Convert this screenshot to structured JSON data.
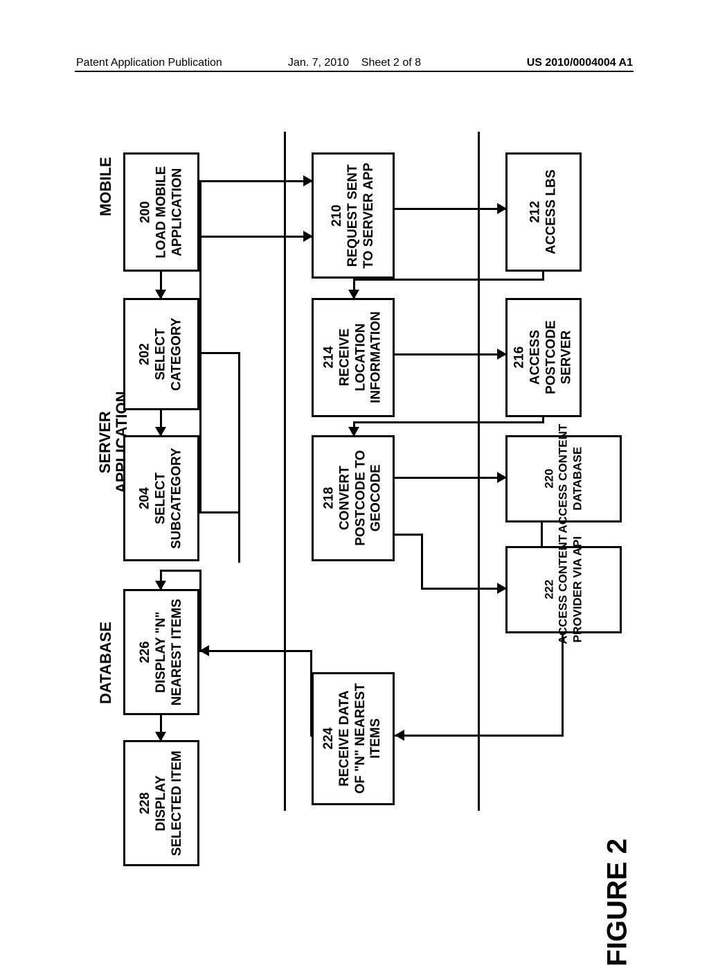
{
  "header": {
    "left": "Patent Application Publication",
    "mid_date": "Jan. 7, 2010",
    "mid_sheet": "Sheet 2 of 8",
    "right": "US 2010/0004004 A1"
  },
  "figure_label": "FIGURE 2",
  "lanes": {
    "mobile": "MOBILE",
    "server": "SERVER\nAPPLICATION",
    "database": "DATABASE"
  },
  "boxes": {
    "b200": "200\nLOAD MOBILE\nAPPLICATION",
    "b202": "202\nSELECT\nCATEGORY",
    "b204": "204\nSELECT\nSUBCATEGORY",
    "b210": "210\nREQUEST SENT\nTO SERVER APP",
    "b212": "212\nACCESS LBS",
    "b214": "214\nRECEIVE\nLOCATION\nINFORMATION",
    "b216": "216\nACCESS\nPOSTCODE\nSERVER",
    "b218": "218\nCONVERT\nPOSTCODE TO\nGEOCODE",
    "b220": "220\nACCESS CONTENT\nDATABASE",
    "b222": "222\nACCESS CONTENT\nPROVIDER VIA API",
    "b224": "224\nRECEIVE DATA\nOF \"N\" NEAREST\nITEMS",
    "b226": "226\nDISPLAY \"N\"\nNEAREST ITEMS",
    "b228": "228\nDISPLAY\nSELECTED ITEM"
  }
}
